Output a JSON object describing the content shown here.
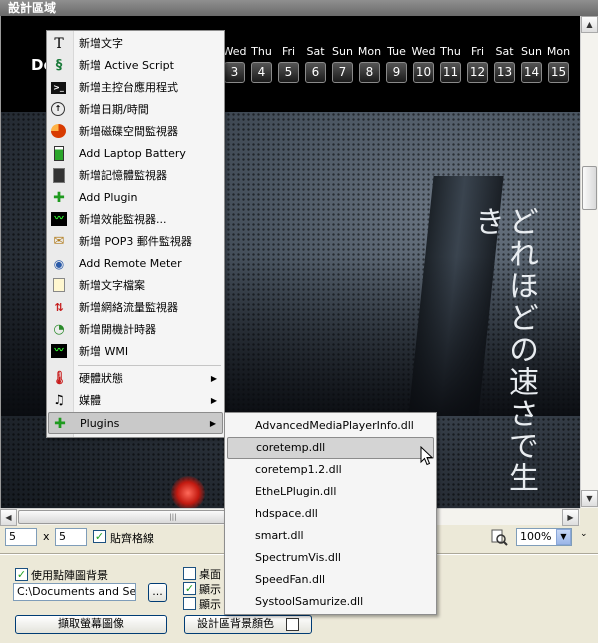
{
  "window": {
    "title": "設計區域"
  },
  "calendar": {
    "month_label": "De",
    "days": [
      {
        "name": "Wed",
        "date": "3"
      },
      {
        "name": "Thu",
        "date": "4"
      },
      {
        "name": "Fri",
        "date": "5"
      },
      {
        "name": "Sat",
        "date": "6"
      },
      {
        "name": "Sun",
        "date": "7"
      },
      {
        "name": "Mon",
        "date": "8"
      },
      {
        "name": "Tue",
        "date": "9"
      },
      {
        "name": "Wed",
        "date": "10"
      },
      {
        "name": "Thu",
        "date": "11"
      },
      {
        "name": "Fri",
        "date": "12"
      },
      {
        "name": "Sat",
        "date": "13"
      },
      {
        "name": "Sun",
        "date": "14"
      },
      {
        "name": "Mon",
        "date": "15"
      }
    ]
  },
  "wallpaper": {
    "vertical_text": "どれほどの速さで生き"
  },
  "context_menu": {
    "items": [
      {
        "label": "新增文字",
        "icon": "text-icon"
      },
      {
        "label": "新增 Active Script",
        "icon": "script-icon"
      },
      {
        "label": "新增主控台應用程式",
        "icon": "console-icon"
      },
      {
        "label": "新增日期/時間",
        "icon": "clock-icon"
      },
      {
        "label": "新增磁碟空間監視器",
        "icon": "disk-pie-icon"
      },
      {
        "label": "Add Laptop Battery",
        "icon": "battery-icon"
      },
      {
        "label": "新增記憶體監視器",
        "icon": "memory-icon"
      },
      {
        "label": "Add Plugin",
        "icon": "plugin-icon"
      },
      {
        "label": "新增效能監視器...",
        "icon": "performance-icon"
      },
      {
        "label": "新增 POP3 郵件監視器",
        "icon": "mail-icon"
      },
      {
        "label": "Add Remote Meter",
        "icon": "remote-meter-icon"
      },
      {
        "label": "新增文字檔案",
        "icon": "text-file-icon"
      },
      {
        "label": "新增網絡流量監視器",
        "icon": "network-traffic-icon"
      },
      {
        "label": "新增開機計時器",
        "icon": "uptime-icon"
      },
      {
        "label": "新增 WMI",
        "icon": "wmi-icon"
      }
    ],
    "submenus": [
      {
        "label": "硬體狀態",
        "icon": "thermometer-icon"
      },
      {
        "label": "媒體",
        "icon": "music-note-icon"
      },
      {
        "label": "Plugins",
        "icon": "plugin-icon"
      }
    ]
  },
  "plugins_submenu": {
    "items": [
      "AdvancedMediaPlayerInfo.dll",
      "coretemp.dll",
      "coretemp1.2.dll",
      "EtheLPlugin.dll",
      "hdspace.dll",
      "smart.dll",
      "SpectrumVis.dll",
      "SpeedFan.dll",
      "SystoolSamurize.dll"
    ],
    "highlighted_index": 1
  },
  "grid": {
    "width_value": "5",
    "times": "x",
    "height_value": "5",
    "snap_label": "貼齊格線",
    "snap_checked": true
  },
  "zoom": {
    "value": "100%"
  },
  "background": {
    "use_bitmap_label": "使用點陣圖背景",
    "use_bitmap_checked": true,
    "path_value": "C:\\Documents and Setti",
    "browse_label": "...",
    "capture_label": "擷取螢幕圖像",
    "desktop_label": "桌面",
    "show_label_1": "顯示",
    "show_label_2": "顯示",
    "bg_color_label": "設計區背景顏色"
  }
}
